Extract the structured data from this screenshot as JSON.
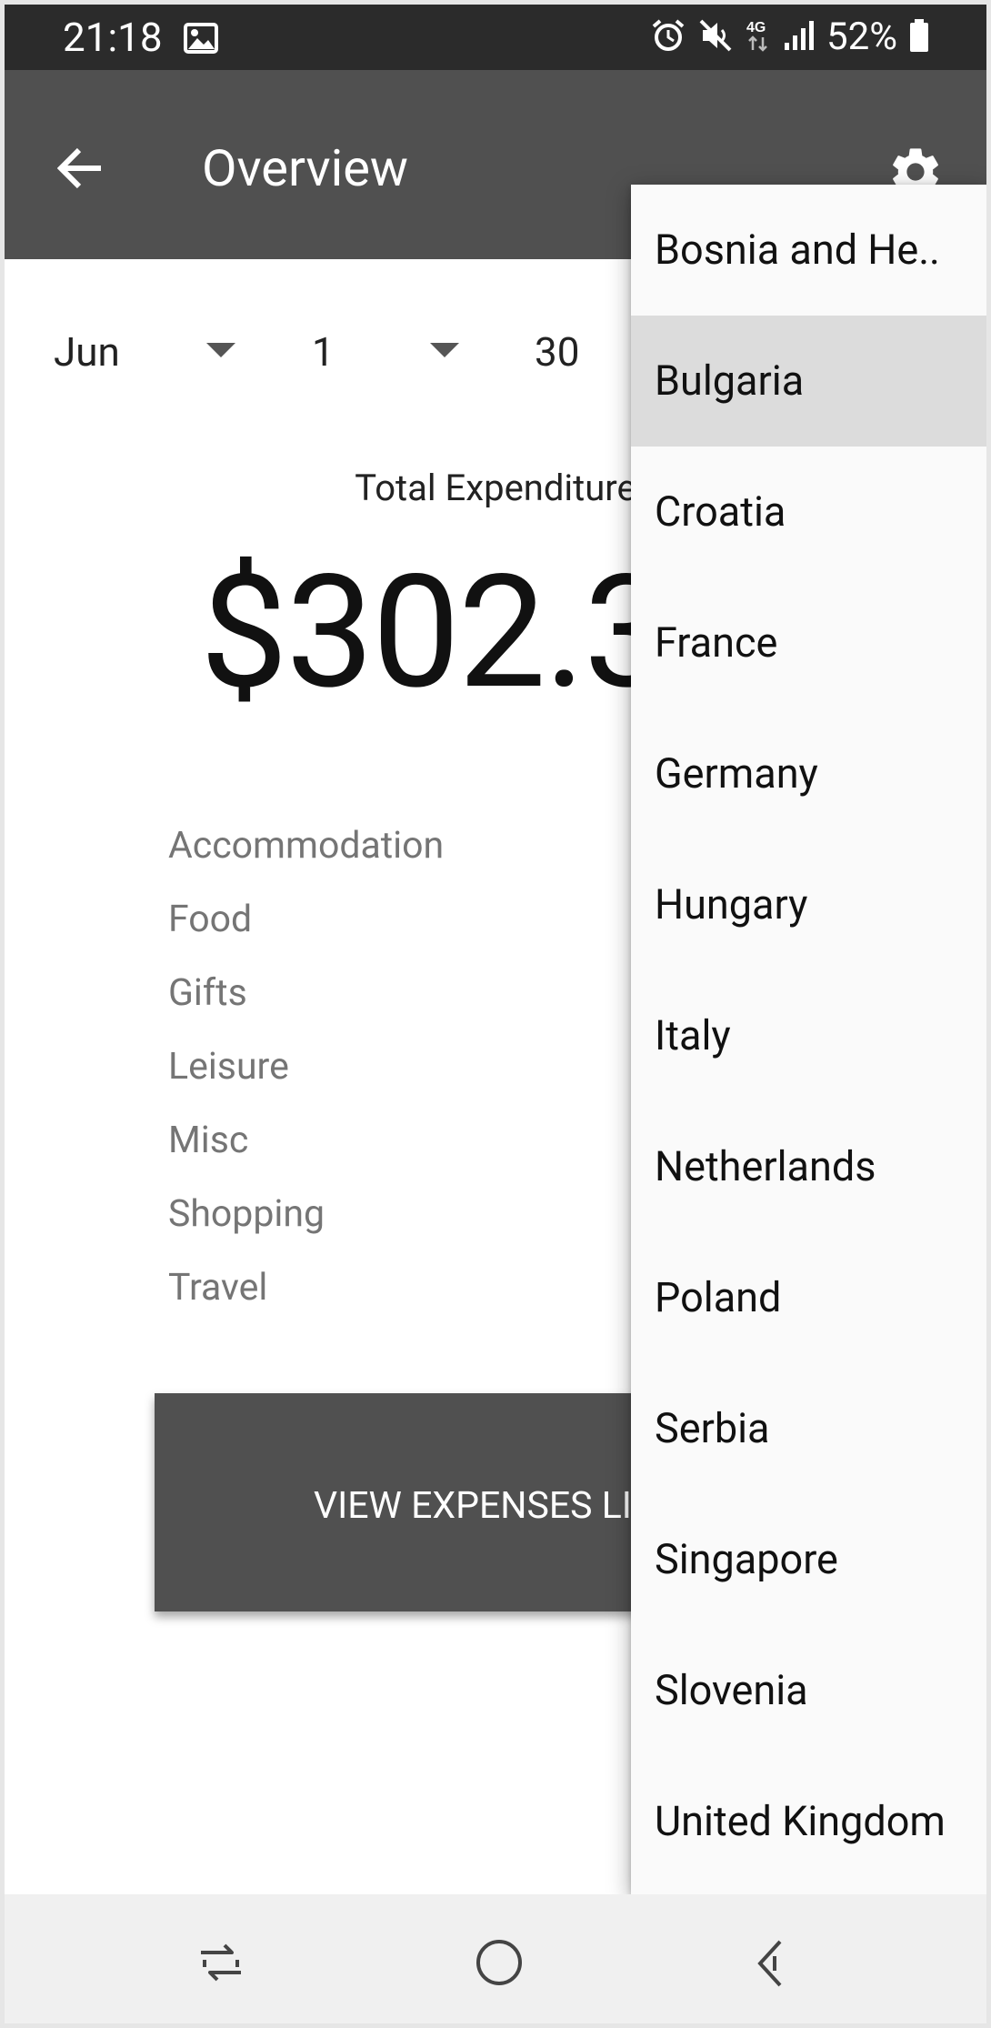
{
  "status_bar": {
    "time": "21:18",
    "battery": "52%",
    "icons": [
      "image-icon",
      "alarm-icon",
      "mute-icon",
      "4g-icon",
      "signal-icon",
      "battery-icon"
    ]
  },
  "app_bar": {
    "title": "Overview",
    "back_icon": "arrow-left-icon",
    "settings_icon": "gear-icon"
  },
  "date_filter": {
    "month": "Jun",
    "start_day": "1",
    "end_day": "30"
  },
  "summary": {
    "total_label": "Total Expenditure",
    "total_amount": "$302.3"
  },
  "categories": [
    "Accommodation",
    "Food",
    "Gifts",
    "Leisure",
    "Misc",
    "Shopping",
    "Travel"
  ],
  "view_button_label": "VIEW EXPENSES LI",
  "dropdown": {
    "items": [
      "Bosnia and He..",
      "Bulgaria",
      "Croatia",
      "France",
      "Germany",
      "Hungary",
      "Italy",
      "Netherlands",
      "Poland",
      "Serbia",
      "Singapore",
      "Slovenia",
      "United Kingdom"
    ],
    "selected": "Bulgaria"
  },
  "colors": {
    "status_bar": "#2b2b2b",
    "app_bar": "#505050",
    "dropdown_bg": "#fafafa",
    "selected_item": "#dcdcdc",
    "nav_bar": "#f0f0f0"
  }
}
